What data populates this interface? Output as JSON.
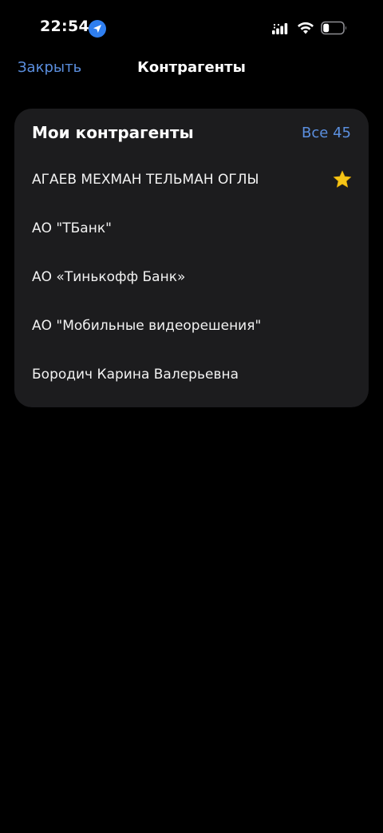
{
  "status_bar": {
    "time": "22:54",
    "icons": [
      "location-arrow-icon",
      "signal-icon",
      "wifi-icon",
      "battery-icon"
    ]
  },
  "nav": {
    "close_label": "Закрыть",
    "title": "Контрагенты"
  },
  "card": {
    "title": "Мои контрагенты",
    "see_all_label": "Все 45",
    "items": [
      {
        "name": "АГАЕВ МЕХМАН ТЕЛЬМАН ОГЛЫ",
        "favorite": true
      },
      {
        "name": "АО \"ТБанк\"",
        "favorite": false
      },
      {
        "name": "АО «Тинькофф Банк»",
        "favorite": false
      },
      {
        "name": "АО \"Мобильные видеорешения\"",
        "favorite": false
      },
      {
        "name": "Бородич Карина Валерьевна",
        "favorite": false
      }
    ]
  },
  "colors": {
    "background": "#000000",
    "card": "#1c1c1e",
    "accent": "#5b8fdf",
    "star": "#f5c518",
    "location_badge": "#2f7ff0"
  }
}
